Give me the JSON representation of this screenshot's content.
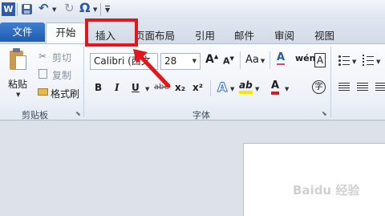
{
  "quick_access": {
    "word_icon": "W",
    "undo_glyph": "↶",
    "redo_glyph": "↻",
    "symbol_glyph": "Ω"
  },
  "tabs": {
    "file": "文件",
    "home": "开始",
    "insert": "插入",
    "page_layout": "页面布局",
    "references": "引用",
    "mailings": "邮件",
    "review": "审阅",
    "view": "视图"
  },
  "clipboard": {
    "paste": "粘贴",
    "cut": "剪切",
    "copy": "复制",
    "format_painter": "格式刷",
    "group_label": "剪贴板"
  },
  "font": {
    "font_name": "Calibri (西文",
    "font_size": "28",
    "grow": "A",
    "shrink": "A",
    "change_case": "Aa",
    "clear_format": "A",
    "phonetic": "wén",
    "border_char": "A",
    "bold": "B",
    "italic": "I",
    "underline": "U",
    "strike": "abe",
    "subscript": "x₂",
    "superscript": "x²",
    "effects": "A",
    "highlight": "ab",
    "font_color": "A",
    "enclose": "字",
    "group_label": "字体"
  },
  "colors": {
    "file_tab": "#2a6bc3",
    "highlight_box": "#e5161b",
    "arrow": "#e5161b",
    "highlight_yellow": "#f5e700",
    "font_red": "#d21e1e"
  },
  "watermark": "Baidu 经验"
}
